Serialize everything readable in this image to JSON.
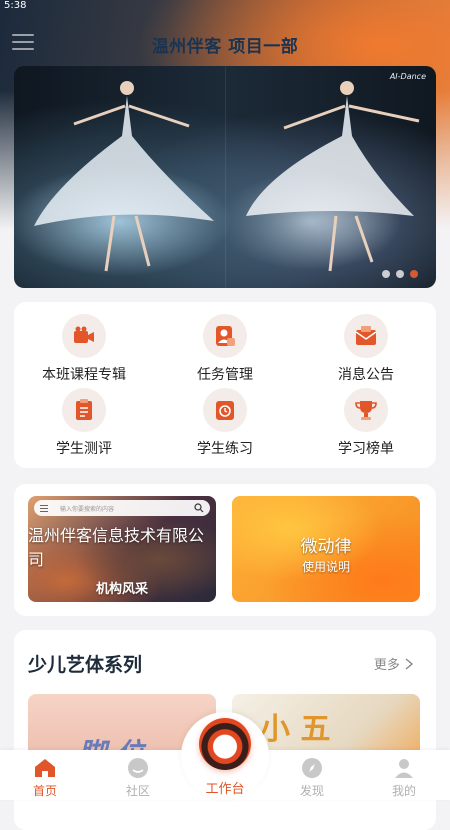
{
  "status_bar": {
    "time": "5:38"
  },
  "header": {
    "title": "温州伴客 项目一部"
  },
  "banner": {
    "tag": "AI-Dance",
    "slide_count": 3,
    "active_slide": 3
  },
  "menu_grid": [
    {
      "label": "本班课程专辑",
      "icon": "video-camera-icon"
    },
    {
      "label": "任务管理",
      "icon": "user-task-icon"
    },
    {
      "label": "消息公告",
      "icon": "envelope-icon"
    },
    {
      "label": "学生测评",
      "icon": "clipboard-icon"
    },
    {
      "label": "学生练习",
      "icon": "practice-icon"
    },
    {
      "label": "学习榜单",
      "icon": "trophy-icon"
    }
  ],
  "promos": {
    "left": {
      "search_placeholder": "输入你要搜索的内容",
      "company": "温州伴客信息技术有限公司",
      "subtitle": "机构风采"
    },
    "right": {
      "title": "微动律",
      "subtitle": "使用说明"
    }
  },
  "series": {
    "title": "少儿艺体系列",
    "more": "更多",
    "thumb_a_text": "脚 位",
    "thumb_b_text": "小 五"
  },
  "tabbar": {
    "home": "首页",
    "community": "社区",
    "workbench": "工作台",
    "discover": "发现",
    "mine": "我的"
  },
  "colors": {
    "accent": "#e0562a",
    "title": "#1a3350"
  }
}
